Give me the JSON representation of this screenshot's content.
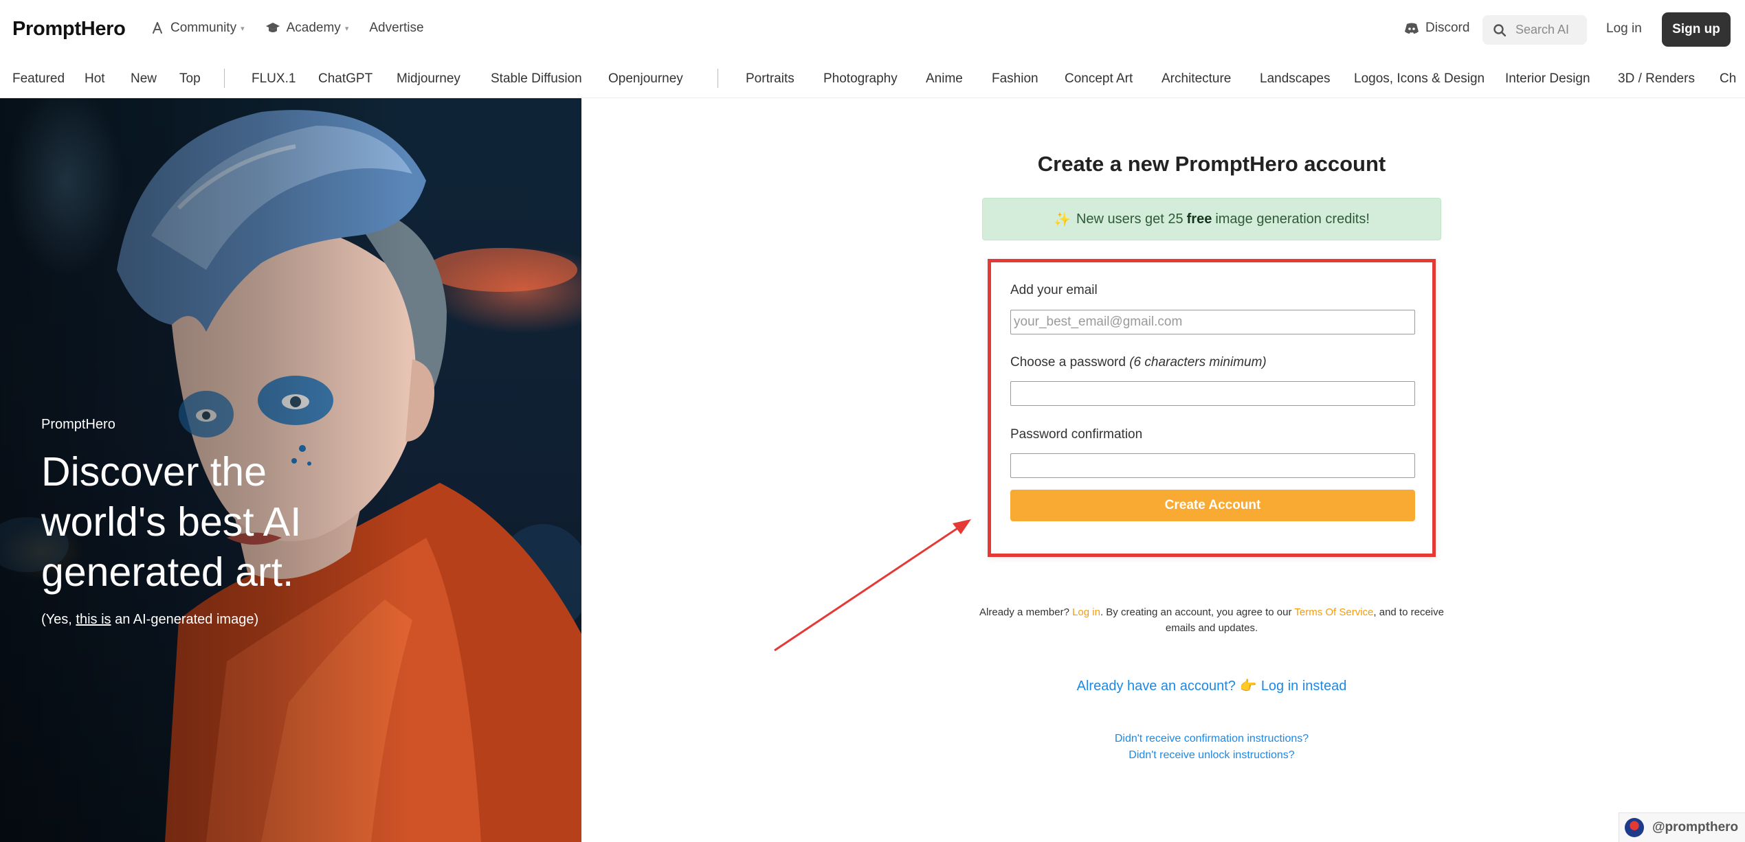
{
  "header": {
    "logo": "PromptHero",
    "nav": [
      {
        "label": "Community",
        "icon": "community-icon",
        "dropdown": true
      },
      {
        "label": "Academy",
        "icon": "academy-cap-icon",
        "dropdown": true
      },
      {
        "label": "Advertise",
        "icon": "",
        "dropdown": false
      }
    ],
    "discord_label": "Discord",
    "search_placeholder": "Search AI in",
    "login_label": "Log in",
    "signup_label": "Sign up"
  },
  "categories": {
    "group1": [
      "Featured",
      "Hot",
      "New",
      "Top"
    ],
    "group2": [
      "FLUX.1",
      "ChatGPT",
      "Midjourney",
      "Stable Diffusion",
      "Openjourney"
    ],
    "group3": [
      "Portraits",
      "Photography",
      "Anime",
      "Fashion",
      "Concept Art",
      "Architecture",
      "Landscapes",
      "Logos, Icons & Design",
      "Interior Design",
      "3D / Renders",
      "Ch"
    ]
  },
  "hero": {
    "brand": "PromptHero",
    "title": "Discover the world's best AI generated art.",
    "caption_prefix": "(Yes, ",
    "caption_link": "this is",
    "caption_suffix": " an AI-generated image)"
  },
  "form": {
    "page_title": "Create a new PromptHero account",
    "promo_prefix": "New users get 25",
    "promo_bold": "free",
    "promo_suffix": "image generation credits!",
    "promo_emoji": "✨",
    "email_label": "Add your email",
    "email_placeholder": "your_best_email@gmail.com",
    "password_label": "Choose a password",
    "password_hint": "(6 characters minimum)",
    "confirm_label": "Password confirmation",
    "submit_label": "Create Account"
  },
  "footer_text": {
    "terms_a": "Already a member? ",
    "terms_login": "Log in",
    "terms_b": ". By creating an account, you agree to our ",
    "terms_tos": "Terms Of Service",
    "terms_c": ", and to receive emails and updates.",
    "login_instead_a": "Already have an account?",
    "login_instead_hand": "👉",
    "login_instead_b": "Log in instead",
    "help_1": "Didn't receive confirmation instructions?",
    "help_2": "Didn't receive unlock instructions?"
  },
  "badge": {
    "handle": "@prompthero"
  },
  "colors": {
    "accent_orange": "#f9aa33",
    "link_blue": "#1e88e5",
    "highlight_red": "#e53935",
    "promo_green": "#d4edda"
  }
}
